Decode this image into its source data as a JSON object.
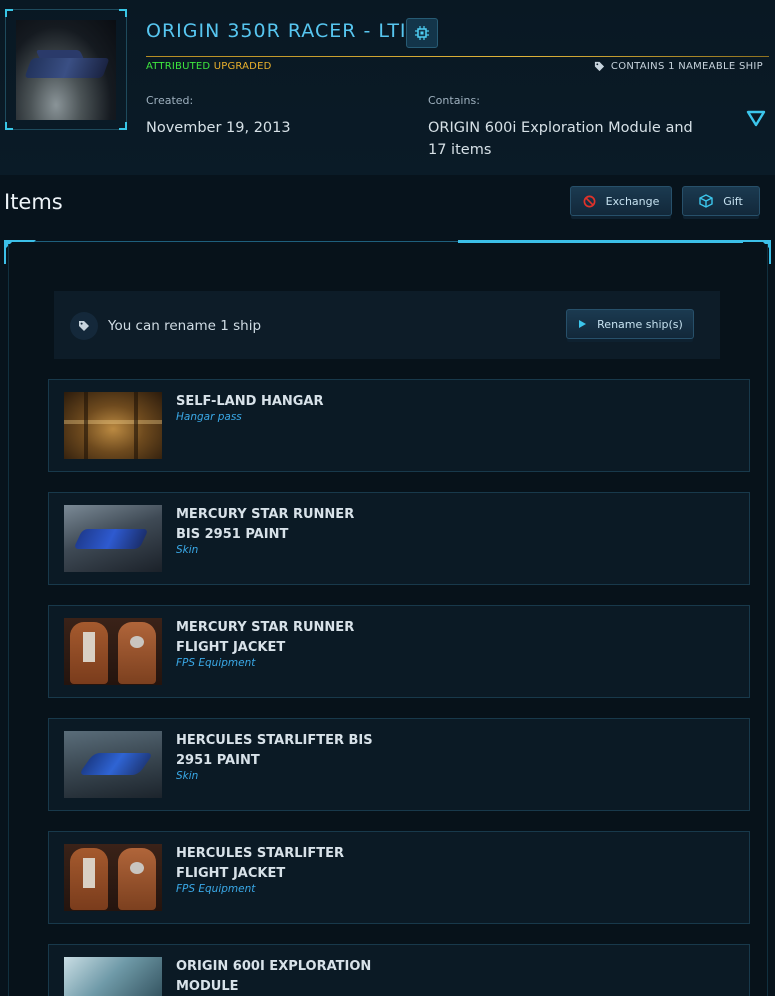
{
  "header": {
    "title": "ORIGIN 350R RACER - LTI",
    "attributed": "ATTRIBUTED",
    "upgraded": "UPGRADED",
    "nameable": "CONTAINS 1 NAMEABLE SHIP",
    "created_label": "Created:",
    "created_value": "November 19, 2013",
    "contains_label": "Contains:",
    "contains_line1": "ORIGIN 600i Exploration Module and",
    "contains_line2": "17 items"
  },
  "items_section": {
    "title": "Items",
    "exchange_label": "Exchange",
    "gift_label": "Gift",
    "rename_text": "You can rename 1 ship",
    "rename_button": "Rename ship(s)"
  },
  "items": [
    {
      "name1": "SELF-LAND HANGAR",
      "name2": "",
      "type": "Hangar pass",
      "icon": "hangar-image"
    },
    {
      "name1": "MERCURY STAR RUNNER",
      "name2": "BIS 2951 PAINT",
      "type": "Skin",
      "icon": "ship-skin-image"
    },
    {
      "name1": "MERCURY STAR RUNNER",
      "name2": "FLIGHT JACKET",
      "type": "FPS Equipment",
      "icon": "jacket-image"
    },
    {
      "name1": "HERCULES STARLIFTER BIS",
      "name2": "2951 PAINT",
      "type": "Skin",
      "icon": "ship-skin-image"
    },
    {
      "name1": "HERCULES STARLIFTER",
      "name2": "FLIGHT JACKET",
      "type": "FPS Equipment",
      "icon": "jacket-image"
    },
    {
      "name1": "ORIGIN 600I EXPLORATION",
      "name2": "MODULE",
      "type": "",
      "icon": "module-image"
    }
  ],
  "colors": {
    "accent": "#57c6f0",
    "attributed": "#3ee63e",
    "upgraded": "#e9b02c",
    "type_text": "#3aa8e6",
    "background": "#07131c"
  }
}
